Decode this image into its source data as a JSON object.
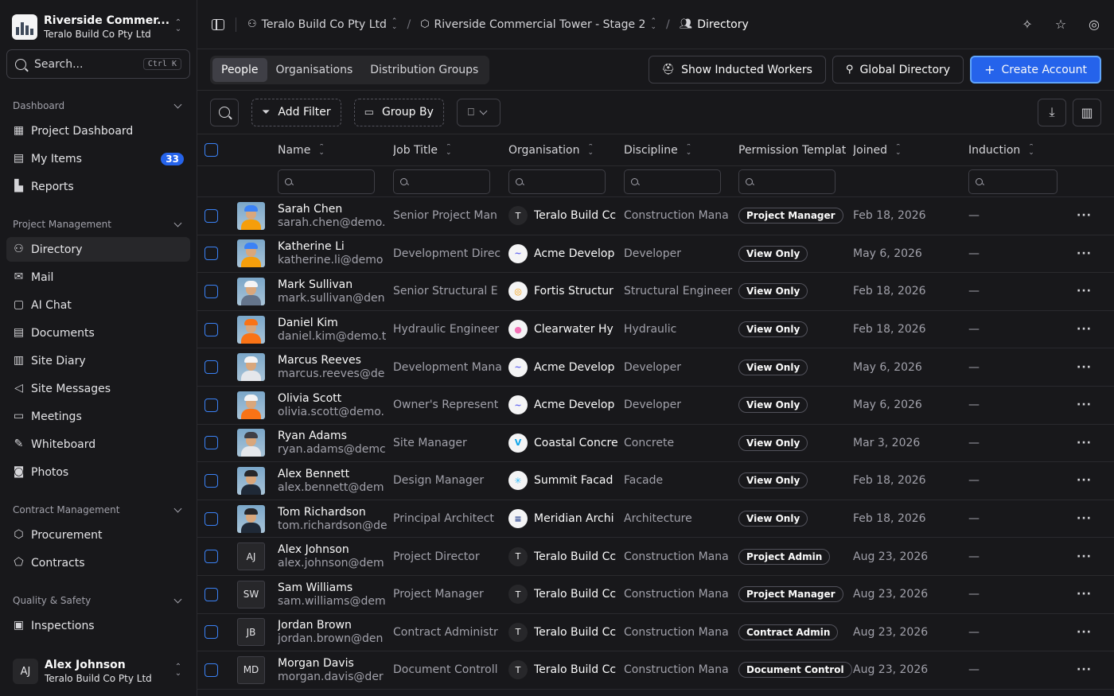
{
  "workspace": {
    "name": "Riverside Commer...",
    "org": "Teralo Build Co Pty Ltd"
  },
  "search": {
    "placeholder": "Search...",
    "shortcut": "Ctrl K"
  },
  "sidebar": {
    "sections": [
      {
        "title": "Dashboard",
        "items": [
          {
            "label": "Project Dashboard",
            "icon": "grid-icon"
          },
          {
            "label": "My Items",
            "icon": "clipboard-icon",
            "badge": "33"
          },
          {
            "label": "Reports",
            "icon": "chart-icon"
          }
        ]
      },
      {
        "title": "Project Management",
        "items": [
          {
            "label": "Directory",
            "icon": "users-icon",
            "active": true
          },
          {
            "label": "Mail",
            "icon": "mail-icon"
          },
          {
            "label": "AI Chat",
            "icon": "chat-icon"
          },
          {
            "label": "Documents",
            "icon": "document-icon"
          },
          {
            "label": "Site Diary",
            "icon": "book-icon"
          },
          {
            "label": "Site Messages",
            "icon": "megaphone-icon"
          },
          {
            "label": "Meetings",
            "icon": "monitor-icon"
          },
          {
            "label": "Whiteboard",
            "icon": "pen-icon"
          },
          {
            "label": "Photos",
            "icon": "camera-icon"
          }
        ]
      },
      {
        "title": "Contract Management",
        "items": [
          {
            "label": "Procurement",
            "icon": "package-icon"
          },
          {
            "label": "Contracts",
            "icon": "handshake-icon"
          }
        ]
      },
      {
        "title": "Quality & Safety",
        "items": [
          {
            "label": "Inspections",
            "icon": "clipboard-check-icon"
          }
        ]
      }
    ]
  },
  "user": {
    "initials": "AJ",
    "name": "Alex Johnson",
    "org": "Teralo Build Co Pty Ltd"
  },
  "breadcrumb": {
    "org": "Teralo Build Co Pty Ltd",
    "project": "Riverside Commercial Tower - Stage 2",
    "page": "Directory"
  },
  "tabs": [
    "People",
    "Organisations",
    "Distribution Groups"
  ],
  "actions": {
    "inducted": "Show Inducted Workers",
    "global": "Global Directory",
    "create": "Create Account"
  },
  "filters": {
    "add_filter": "Add Filter",
    "group_by": "Group By"
  },
  "columns": {
    "name": "Name",
    "job": "Job Title",
    "org": "Organisation",
    "discipline": "Discipline",
    "permission": "Permission Templat",
    "joined": "Joined",
    "induction": "Induction"
  },
  "rows": [
    {
      "name": "Sarah Chen",
      "email": "sarah.chen@demo.",
      "job": "Senior Project Man",
      "org": "Teralo Build Cc",
      "org_logo": "T",
      "discipline": "Construction Mana",
      "permission": "Project Manager",
      "joined": "Feb 18, 2026",
      "induction": "—",
      "avatar": "photo",
      "hat": "#3b82f6",
      "shirt": "#f59e0b"
    },
    {
      "name": "Katherine Li",
      "email": "katherine.li@demo",
      "job": "Development Direc",
      "org": "Acme Develop",
      "org_logo": "~",
      "discipline": "Developer",
      "permission": "View Only",
      "joined": "May 6, 2026",
      "induction": "—",
      "avatar": "photo",
      "hat": "#3b82f6",
      "shirt": "#f59e0b"
    },
    {
      "name": "Mark Sullivan",
      "email": "mark.sullivan@den",
      "job": "Senior Structural E",
      "org": "Fortis Structur",
      "org_logo": "◎",
      "discipline": "Structural Engineer",
      "permission": "View Only",
      "joined": "Feb 18, 2026",
      "induction": "—",
      "avatar": "photo",
      "hat": "#f4f4f5",
      "shirt": "#64748b"
    },
    {
      "name": "Daniel Kim",
      "email": "daniel.kim@demo.t",
      "job": "Hydraulic Engineer",
      "org": "Clearwater Hy",
      "org_logo": "●",
      "discipline": "Hydraulic",
      "permission": "View Only",
      "joined": "Feb 18, 2026",
      "induction": "—",
      "avatar": "photo",
      "hat": "#f97316",
      "shirt": "#f97316"
    },
    {
      "name": "Marcus Reeves",
      "email": "marcus.reeves@de",
      "job": "Development Mana",
      "org": "Acme Develop",
      "org_logo": "~",
      "discipline": "Developer",
      "permission": "View Only",
      "joined": "May 6, 2026",
      "induction": "—",
      "avatar": "photo",
      "hat": "#f4f4f5",
      "shirt": "#e5e7eb"
    },
    {
      "name": "Olivia Scott",
      "email": "olivia.scott@demo.",
      "job": "Owner's Represent",
      "org": "Acme Develop",
      "org_logo": "~",
      "discipline": "Developer",
      "permission": "View Only",
      "joined": "May 6, 2026",
      "induction": "—",
      "avatar": "photo",
      "hat": "#f4f4f5",
      "shirt": "#f97316"
    },
    {
      "name": "Ryan Adams",
      "email": "ryan.adams@demc",
      "job": "Site Manager",
      "org": "Coastal Concre",
      "org_logo": "V",
      "discipline": "Concrete",
      "permission": "View Only",
      "joined": "Mar 3, 2026",
      "induction": "—",
      "avatar": "photo",
      "hat": "#3f3f46",
      "shirt": "#e5e7eb"
    },
    {
      "name": "Alex Bennett",
      "email": "alex.bennett@dem",
      "job": "Design Manager",
      "org": "Summit Facad",
      "org_logo": "✳",
      "discipline": "Facade",
      "permission": "View Only",
      "joined": "Feb 18, 2026",
      "induction": "—",
      "avatar": "photo",
      "hat": "#27272a",
      "shirt": "#1f2937"
    },
    {
      "name": "Tom Richardson",
      "email": "tom.richardson@de",
      "job": "Principal Architect",
      "org": "Meridian Archi",
      "org_logo": "≡",
      "discipline": "Architecture",
      "permission": "View Only",
      "joined": "Feb 18, 2026",
      "induction": "—",
      "avatar": "photo",
      "hat": "#27272a",
      "shirt": "#1f2937"
    },
    {
      "name": "Alex Johnson",
      "email": "alex.johnson@dem",
      "job": "Project Director",
      "org": "Teralo Build Cc",
      "org_logo": "T",
      "discipline": "Construction Mana",
      "permission": "Project Admin",
      "joined": "Aug 23, 2026",
      "induction": "—",
      "avatar": "AJ"
    },
    {
      "name": "Sam Williams",
      "email": "sam.williams@dem",
      "job": "Project Manager",
      "org": "Teralo Build Cc",
      "org_logo": "T",
      "discipline": "Construction Mana",
      "permission": "Project Manager",
      "joined": "Aug 23, 2026",
      "induction": "—",
      "avatar": "SW"
    },
    {
      "name": "Jordan Brown",
      "email": "jordan.brown@den",
      "job": "Contract Administr",
      "org": "Teralo Build Cc",
      "org_logo": "T",
      "discipline": "Construction Mana",
      "permission": "Contract Admin",
      "joined": "Aug 23, 2026",
      "induction": "—",
      "avatar": "JB"
    },
    {
      "name": "Morgan Davis",
      "email": "morgan.davis@der",
      "job": "Document Controll",
      "org": "Teralo Build Cc",
      "org_logo": "T",
      "discipline": "Construction Mana",
      "permission": "Document Control",
      "joined": "Aug 23, 2026",
      "induction": "—",
      "avatar": "MD"
    }
  ],
  "colors": {
    "accent": "#2563eb",
    "background": "#18181b",
    "border": "#2a2a2e"
  }
}
